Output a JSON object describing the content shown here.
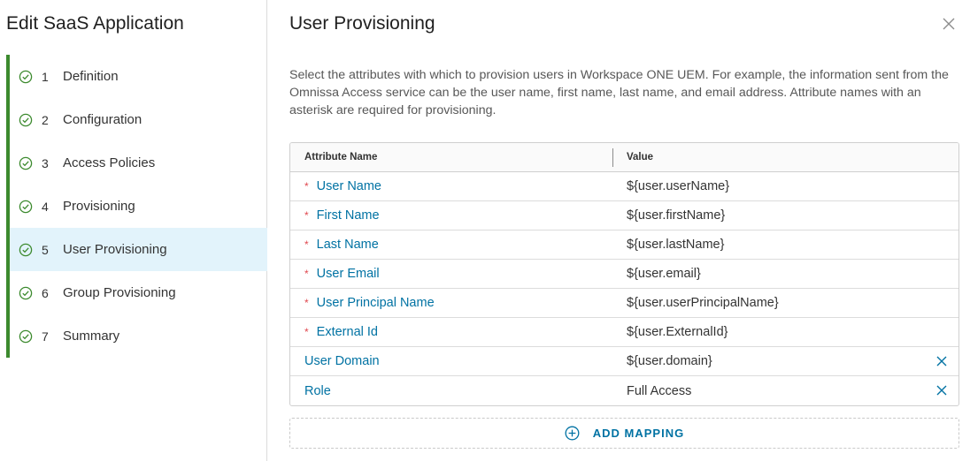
{
  "sidebar": {
    "title": "Edit SaaS Application",
    "steps": [
      {
        "num": "1",
        "label": "Definition"
      },
      {
        "num": "2",
        "label": "Configuration"
      },
      {
        "num": "3",
        "label": "Access Policies"
      },
      {
        "num": "4",
        "label": "Provisioning"
      },
      {
        "num": "5",
        "label": "User Provisioning",
        "active": true
      },
      {
        "num": "6",
        "label": "Group Provisioning"
      },
      {
        "num": "7",
        "label": "Summary"
      }
    ]
  },
  "main": {
    "title": "User Provisioning",
    "description": "Select the attributes with which to provision users in Workspace ONE UEM. For example, the information sent from the Omnissa Access service can be the user name, first name, last name, and email address. Attribute names with an asterisk are required for provisioning.",
    "table": {
      "headers": {
        "name": "Attribute Name",
        "value": "Value"
      },
      "rows": [
        {
          "name": "User Name",
          "value": "${user.userName}",
          "required": true
        },
        {
          "name": "First Name",
          "value": "${user.firstName}",
          "required": true
        },
        {
          "name": "Last Name",
          "value": "${user.lastName}",
          "required": true
        },
        {
          "name": "User Email",
          "value": "${user.email}",
          "required": true
        },
        {
          "name": "User Principal Name",
          "value": "${user.userPrincipalName}",
          "required": true
        },
        {
          "name": "External Id",
          "value": "${user.ExternalId}",
          "required": true
        },
        {
          "name": "User Domain",
          "value": "${user.domain}",
          "required": false,
          "deletable": true
        },
        {
          "name": "Role",
          "value": "Full Access",
          "required": false,
          "deletable": true
        }
      ],
      "required_marker": "*"
    },
    "add_mapping_label": "ADD MAPPING"
  },
  "icons": {
    "step_status": "check-circle-icon",
    "close": "close-icon",
    "delete": "close-icon",
    "add": "plus-circle-icon"
  },
  "colors": {
    "step_bar": "#3c8a2e",
    "active_step_bg": "#e2f3fb",
    "link": "#0072a3",
    "required": "#e0484f"
  }
}
